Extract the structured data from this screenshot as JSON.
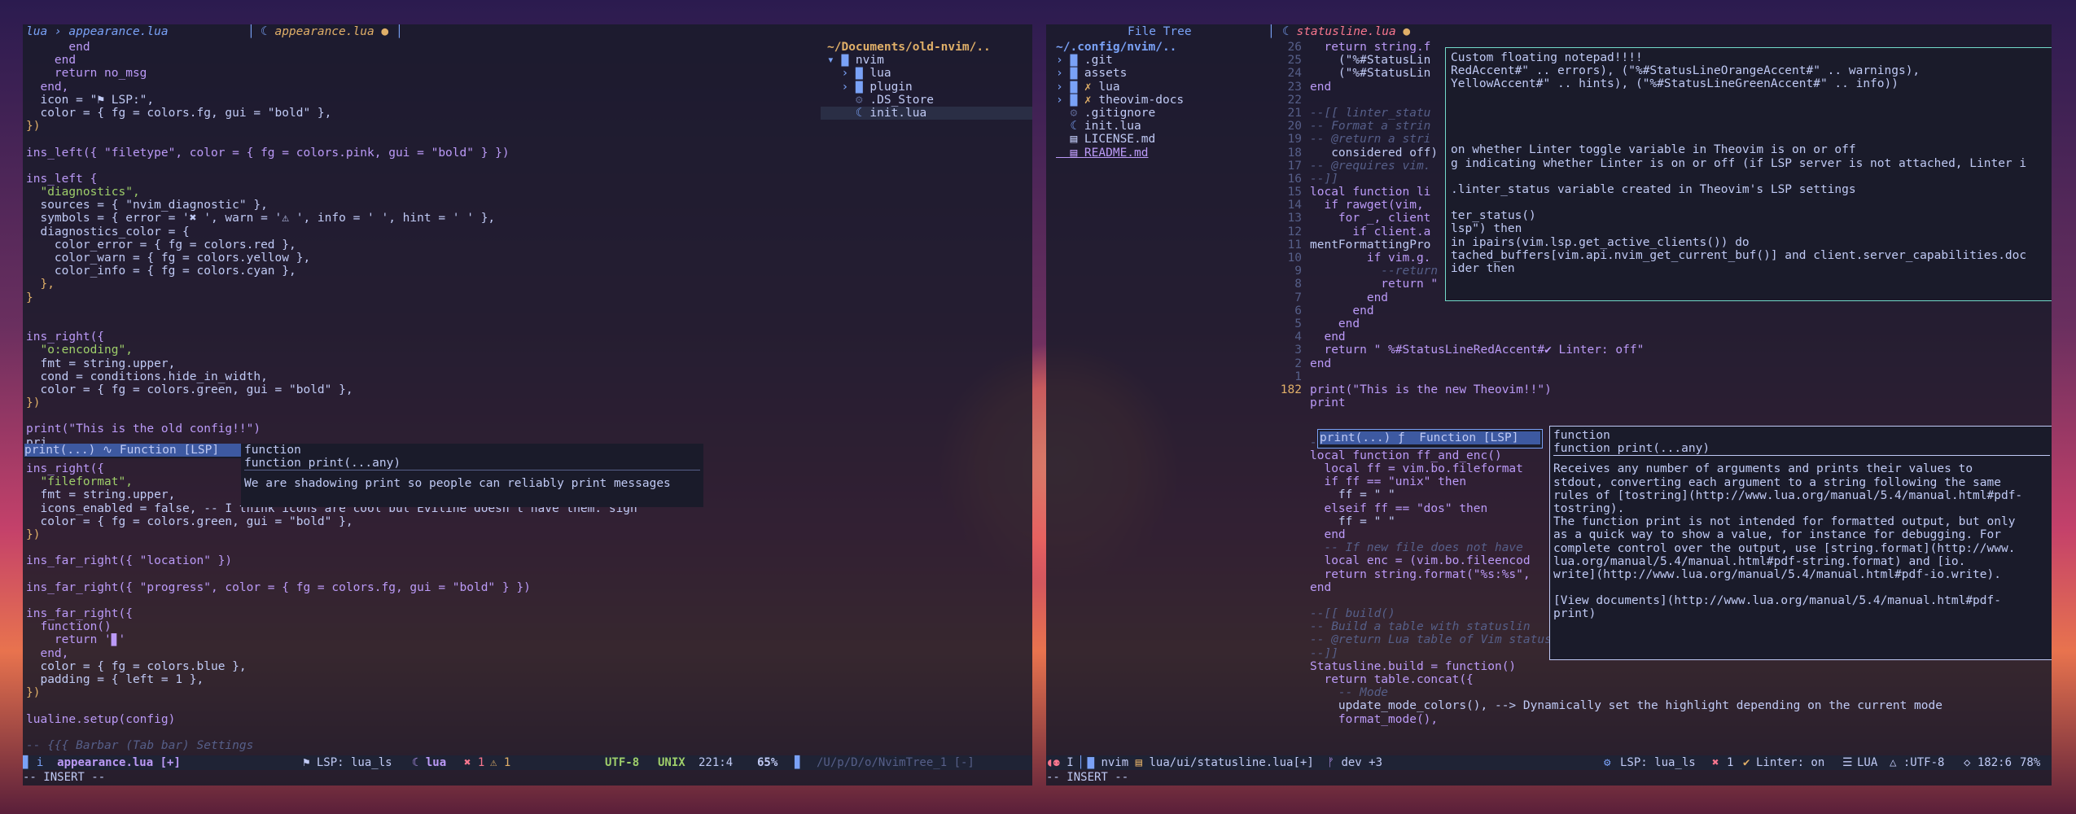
{
  "left": {
    "breadcrumb": "lua › appearance.lua",
    "tab_label": "appearance.lua",
    "tab_modified": "●",
    "code": [
      "      end",
      "    end",
      "    return no_msg",
      "  end,",
      "  icon = \"⚑ LSP:\",",
      "  color = { fg = colors.fg, gui = \"bold\" },",
      "})",
      "",
      "ins_left({ \"filetype\", color = { fg = colors.pink, gui = \"bold\" } })",
      "",
      "ins_left {",
      "  \"diagnostics\",",
      "  sources = { \"nvim_diagnostic\" },",
      "  symbols = { error = '✖ ', warn = '⚠ ', info = ' ', hint = ' ' },",
      "  diagnostics_color = {",
      "    color_error = { fg = colors.red },",
      "    color_warn = { fg = colors.yellow },",
      "    color_info = { fg = colors.cyan },",
      "  },",
      "}",
      "",
      "",
      "ins_right({",
      "  \"o:encoding\",",
      "  fmt = string.upper,",
      "  cond = conditions.hide_in_width,",
      "  color = { fg = colors.green, gui = \"bold\" },",
      "})",
      "",
      "print(\"This is the old config!!\")",
      "pri",
      "",
      "ins_right({",
      "  \"fileformat\",",
      "  fmt = string.upper,",
      "  icons_enabled = false, -- I think icons are cool but Eviline doesn't have them. sigh",
      "  color = { fg = colors.green, gui = \"bold\" },",
      "})",
      "",
      "ins_far_right({ \"location\" })",
      "",
      "ins_far_right({ \"progress\", color = { fg = colors.fg, gui = \"bold\" } })",
      "",
      "ins_far_right({",
      "  function()",
      "    return '▊'",
      "  end,",
      "  color = { fg = colors.blue },",
      "  padding = { left = 1 },",
      "})",
      "",
      "lualine.setup(config)",
      "",
      "-- {{{ Barbar (Tab bar) Settings"
    ],
    "completion_item": "print(...) ∿ Function [LSP]",
    "doc_lines": [
      "function",
      "function print(...any)",
      "",
      "We are shadowing print so people can reliably print messages"
    ],
    "tree": {
      "root": "~/Documents/old-nvim/..",
      "items": [
        "nvim",
        "lua",
        "plugin",
        ".DS_Store",
        "init.lua"
      ]
    },
    "status": {
      "mode_indicator": "i",
      "filename": "appearance.lua [+]",
      "lsp": "LSP: lua_ls",
      "filetype": "lua",
      "errors": "1",
      "warnings": "1",
      "encoding": "UTF-8",
      "format": "UNIX",
      "location": "221:4",
      "progress": "65%",
      "tree_path": "/U/p/D/o/NvimTree_1 [-]"
    },
    "mode_line": "-- INSERT --"
  },
  "right": {
    "tree_title": "File Tree",
    "tab_label": "statusline.lua",
    "tab_modified": "●",
    "tree": {
      "root": "~/.config/nvim/..",
      "items": [
        ".git",
        "assets",
        "lua",
        "theovim-docs",
        ".gitignore",
        "init.lua",
        "LICENSE.md",
        "README.md"
      ]
    },
    "gutter": [
      "26",
      "25",
      "24",
      "23",
      "22",
      "21",
      "20",
      "19",
      "18",
      "17",
      "16",
      "15",
      "14",
      "13",
      "12",
      "11",
      "10",
      "9",
      "8",
      "7",
      "6",
      "5",
      "4",
      "3",
      "2",
      "1",
      "182",
      "",
      "",
      "",
      "",
      "",
      "",
      "",
      "",
      "",
      "",
      "",
      "",
      "",
      "",
      "",
      "",
      "",
      "",
      "",
      "",
      "",
      "",
      "",
      "",
      "",
      ""
    ],
    "code": [
      "  return string.f",
      "    (\"%#StatusLin",
      "    (\"%#StatusLin",
      "end",
      "",
      "--[[ linter_statu",
      "-- Format a strin",
      "-- @return a stri",
      "   considered off)",
      "-- @requires vim.",
      "--]]",
      "local function li",
      "  if rawget(vim,",
      "    for _, client",
      "      if client.a",
      "mentFormattingPro",
      "        if vim.g.",
      "          --return \" %#StatusLineYellowAccent#✔ Linter: ◐\"",
      "          return \" %#StatusLineYellowAccent#✔ Linter: on\"",
      "        end",
      "      end",
      "    end",
      "  end",
      "  return \" %#StatusLineRedAccent#✔ Linter: off\"",
      "end",
      "",
      "print(\"This is the new Theovim!!\")",
      "print",
      "",
      "",
      "--]]",
      "local function ff_and_enc()",
      "  local ff = vim.bo.fileformat",
      "  if ff == \"unix\" then",
      "    ff = \" \"",
      "  elseif ff == \"dos\" then",
      "    ff = \" \"",
      "  end",
      "  -- If new file does not have",
      "  local enc = (vim.bo.fileencod",
      "  return string.format(\"%s:%s\",",
      "end",
      "",
      "--[[ build()",
      "-- Build a table with statuslin",
      "-- @return Lua table of Vim statusline components",
      "--]]",
      "Statusline.build = function()",
      "  return table.concat({",
      "    -- Mode",
      "    update_mode_colors(), --> Dynamically set the highlight depending on the current mode",
      "    format_mode(),"
    ],
    "notepad": {
      "title": "Custom floating notepad!!!!",
      "lines": [
        "RedAccent#\" .. errors), (\"%#StatusLineOrangeAccent#\" .. warnings),",
        "YellowAccent#\" .. hints), (\"%#StatusLineGreenAccent#\" .. info))",
        "",
        "",
        "",
        "",
        "on whether Linter toggle variable in Theovim is on or off",
        "g indicating whether Linter is on or off (if LSP server is not attached, Linter i",
        "",
        ".linter_status variable created in Theovim's LSP settings",
        "",
        "ter_status()",
        "lsp\") then",
        "in ipairs(vim.lsp.get_active_clients()) do",
        "tached_buffers[vim.api.nvim_get_current_buf()] and client.server_capabilities.doc",
        "ider then"
      ]
    },
    "completion_item": "print(...) ƒ  Function [LSP]",
    "doc_lines": [
      "function",
      "function print(...any)",
      "",
      "Receives any number of arguments and prints their values to",
      "stdout, converting each argument to a string following the same",
      "rules of [tostring](http://www.lua.org/manual/5.4/manual.html#pdf-",
      "tostring).",
      "The function print is not intended for formatted output, but only",
      "as a quick way to show a value, for instance for debugging. For",
      "complete control over the output, use [string.format](http://www.",
      "lua.org/manual/5.4/manual.html#pdf-string.format) and [io.",
      "write](http://www.lua.org/manual/5.4/manual.html#pdf-io.write).",
      "",
      "[View documents](http://www.lua.org/manual/5.4/manual.html#pdf-",
      "print)"
    ],
    "status": {
      "mode_indicator": "I",
      "cwd": "nvim",
      "file": "lua/ui/statusline.lua[+]",
      "branch": "dev +3",
      "lsp": "LSP: lua_ls",
      "errors": "1",
      "linter": "Linter: on",
      "filetype": "LUA",
      "encoding": ":UTF-8",
      "location": "182:6",
      "progress": "78%"
    },
    "mode_line": "-- INSERT --"
  },
  "colors": {
    "keyword": "#bb9af7",
    "string": "#9ece6a",
    "function": "#7aa2f7",
    "comment": "#565f89",
    "accent": "#e0af68",
    "error": "#f7768e"
  }
}
